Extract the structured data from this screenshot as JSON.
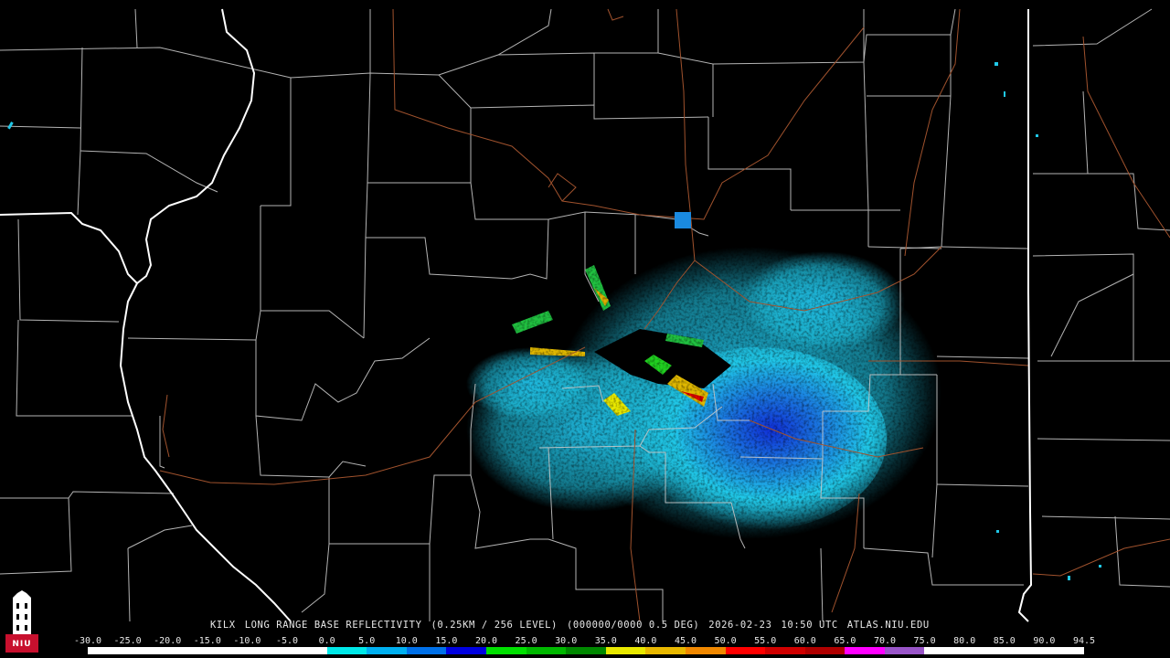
{
  "caption": {
    "station": "KILX",
    "product": "LONG RANGE BASE REFLECTIVITY",
    "resolution": "(0.25KM / 256 LEVEL)",
    "scan": "(000000/0000 0.5 DEG)",
    "date": "2026-02-23",
    "time": "10:50 UTC",
    "source": "ATLAS.NIU.EDU"
  },
  "logo": {
    "text": "NIU",
    "icon": "niu-tower-logo"
  },
  "colorbar": {
    "labels": [
      "-30.0",
      "-25.0",
      "-20.0",
      "-15.0",
      "-10.0",
      "-5.0",
      "0.0",
      "5.0",
      "10.0",
      "15.0",
      "20.0",
      "25.0",
      "30.0",
      "35.0",
      "40.0",
      "45.0",
      "50.0",
      "55.0",
      "60.0",
      "65.0",
      "70.0",
      "75.0",
      "80.0",
      "85.0",
      "90.0",
      "94.5"
    ],
    "colors": [
      "#ffffff",
      "#ffffff",
      "#ffffff",
      "#ffffff",
      "#ffffff",
      "#ffffff",
      "#00e8e8",
      "#00b0f0",
      "#0070e8",
      "#0000e0",
      "#00e000",
      "#00b800",
      "#008800",
      "#e8e800",
      "#e8b800",
      "#f08800",
      "#ff0000",
      "#d00000",
      "#b00000",
      "#ff00ff",
      "#9955c8",
      "#ffffff",
      "#ffffff",
      "#ffffff",
      "#ffffff"
    ]
  },
  "map": {
    "county_line_color": "#c8c8c8",
    "state_line_color": "#ffffff",
    "highway_color": "#a0522d",
    "radar_site": "KILX"
  }
}
